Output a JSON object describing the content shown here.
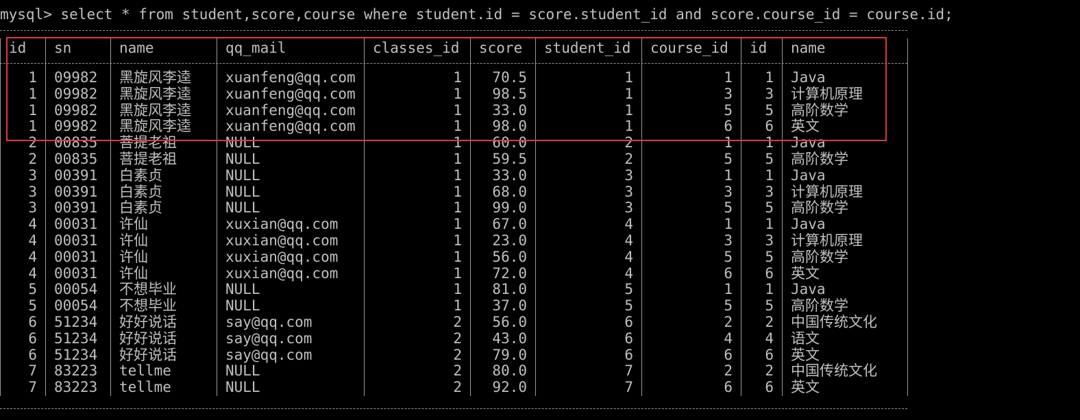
{
  "terminal": {
    "prompt": "mysql>",
    "command": "select * from student,score,course where student.id = score.student_id and score.course_id = course.id;"
  },
  "result": {
    "columns": [
      "id",
      "sn",
      "name",
      "qq_mail",
      "classes_id",
      "score",
      "student_id",
      "course_id",
      "id",
      "name"
    ],
    "rows": [
      [
        "1",
        "09982",
        "黑旋风李逵",
        "xuanfeng@qq.com",
        "1",
        "70.5",
        "1",
        "1",
        "1",
        "Java"
      ],
      [
        "1",
        "09982",
        "黑旋风李逵",
        "xuanfeng@qq.com",
        "1",
        "98.5",
        "1",
        "3",
        "3",
        "计算机原理"
      ],
      [
        "1",
        "09982",
        "黑旋风李逵",
        "xuanfeng@qq.com",
        "1",
        "33.0",
        "1",
        "5",
        "5",
        "高阶数学"
      ],
      [
        "1",
        "09982",
        "黑旋风李逵",
        "xuanfeng@qq.com",
        "1",
        "98.0",
        "1",
        "6",
        "6",
        "英文"
      ],
      [
        "2",
        "00835",
        "菩提老祖",
        "NULL",
        "1",
        "60.0",
        "2",
        "1",
        "1",
        "Java"
      ],
      [
        "2",
        "00835",
        "菩提老祖",
        "NULL",
        "1",
        "59.5",
        "2",
        "5",
        "5",
        "高阶数学"
      ],
      [
        "3",
        "00391",
        "白素贞",
        "NULL",
        "1",
        "33.0",
        "3",
        "1",
        "1",
        "Java"
      ],
      [
        "3",
        "00391",
        "白素贞",
        "NULL",
        "1",
        "68.0",
        "3",
        "3",
        "3",
        "计算机原理"
      ],
      [
        "3",
        "00391",
        "白素贞",
        "NULL",
        "1",
        "99.0",
        "3",
        "5",
        "5",
        "高阶数学"
      ],
      [
        "4",
        "00031",
        "许仙",
        "xuxian@qq.com",
        "1",
        "67.0",
        "4",
        "1",
        "1",
        "Java"
      ],
      [
        "4",
        "00031",
        "许仙",
        "xuxian@qq.com",
        "1",
        "23.0",
        "4",
        "3",
        "3",
        "计算机原理"
      ],
      [
        "4",
        "00031",
        "许仙",
        "xuxian@qq.com",
        "1",
        "56.0",
        "4",
        "5",
        "5",
        "高阶数学"
      ],
      [
        "4",
        "00031",
        "许仙",
        "xuxian@qq.com",
        "1",
        "72.0",
        "4",
        "6",
        "6",
        "英文"
      ],
      [
        "5",
        "00054",
        "不想毕业",
        "NULL",
        "1",
        "81.0",
        "5",
        "1",
        "1",
        "Java"
      ],
      [
        "5",
        "00054",
        "不想毕业",
        "NULL",
        "1",
        "37.0",
        "5",
        "5",
        "5",
        "高阶数学"
      ],
      [
        "6",
        "51234",
        "好好说话",
        "say@qq.com",
        "2",
        "56.0",
        "6",
        "2",
        "2",
        "中国传统文化"
      ],
      [
        "6",
        "51234",
        "好好说话",
        "say@qq.com",
        "2",
        "43.0",
        "6",
        "4",
        "4",
        "语文"
      ],
      [
        "6",
        "51234",
        "好好说话",
        "say@qq.com",
        "2",
        "79.0",
        "6",
        "6",
        "6",
        "英文"
      ],
      [
        "7",
        "83223",
        "tellme",
        "NULL",
        "2",
        "80.0",
        "7",
        "2",
        "2",
        "中国传统文化"
      ],
      [
        "7",
        "83223",
        "tellme",
        "NULL",
        "2",
        "92.0",
        "7",
        "6",
        "6",
        "英文"
      ]
    ]
  },
  "colors": {
    "background": "#000000",
    "text": "#c0c0c0",
    "highlight_border": "#e23a3a"
  }
}
